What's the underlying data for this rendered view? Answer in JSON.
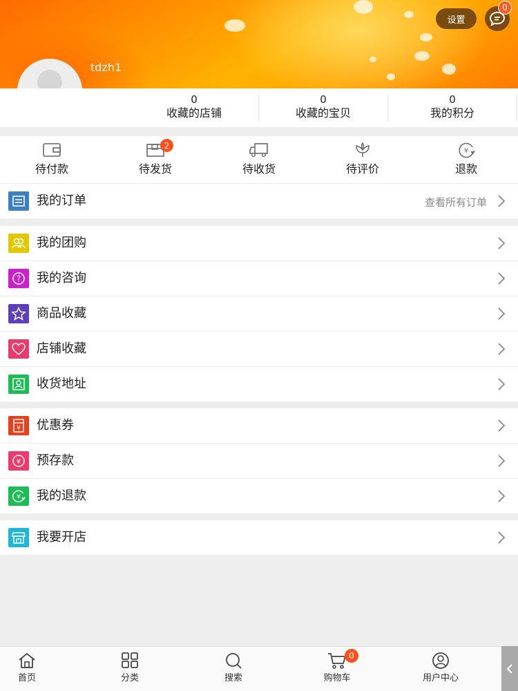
{
  "header": {
    "settings_label": "设置",
    "message_count": "0",
    "username": "tdzh1"
  },
  "stats": [
    {
      "value": "0",
      "label": "收藏的店铺"
    },
    {
      "value": "0",
      "label": "收藏的宝贝"
    },
    {
      "value": "0",
      "label": "我的积分"
    }
  ],
  "order_status": [
    {
      "label": "待付款",
      "icon": "wallet-icon"
    },
    {
      "label": "待发货",
      "icon": "box-icon",
      "badge": "2"
    },
    {
      "label": "待收货",
      "icon": "truck-icon"
    },
    {
      "label": "待评价",
      "icon": "flower-icon"
    },
    {
      "label": "退款",
      "icon": "refund-icon"
    }
  ],
  "my_orders": {
    "label": "我的订单",
    "hint": "查看所有订单"
  },
  "menu_group1": [
    {
      "label": "我的团购",
      "icon": "group-buy-icon",
      "color": "#e2c800"
    },
    {
      "label": "我的咨询",
      "icon": "question-icon",
      "color": "#cc1fce"
    },
    {
      "label": "商品收藏",
      "icon": "star-icon",
      "color": "#5d3fb9"
    },
    {
      "label": "店铺收藏",
      "icon": "heart-icon",
      "color": "#ec3a6c"
    },
    {
      "label": "收货地址",
      "icon": "address-icon",
      "color": "#1dbd55"
    }
  ],
  "menu_group2": [
    {
      "label": "优惠券",
      "icon": "coupon-icon",
      "color": "#e8401c"
    },
    {
      "label": "预存款",
      "icon": "deposit-icon",
      "color": "#ec3a6c"
    },
    {
      "label": "我的退款",
      "icon": "my-refund-icon",
      "color": "#1dbd55"
    }
  ],
  "menu_group3": [
    {
      "label": "我要开店",
      "icon": "store-icon",
      "color": "#20b7d6"
    }
  ],
  "tabbar": [
    {
      "label": "首页",
      "icon": "home-icon"
    },
    {
      "label": "分类",
      "icon": "grid-icon"
    },
    {
      "label": "搜索",
      "icon": "search-icon"
    },
    {
      "label": "购物车",
      "icon": "cart-icon",
      "badge": "0"
    },
    {
      "label": "用户中心",
      "icon": "user-icon"
    }
  ],
  "colors": {
    "accent": "#ff4f1a",
    "header_btn": "#7a4a0e",
    "my_orders_icon": "#3b7fc4"
  }
}
